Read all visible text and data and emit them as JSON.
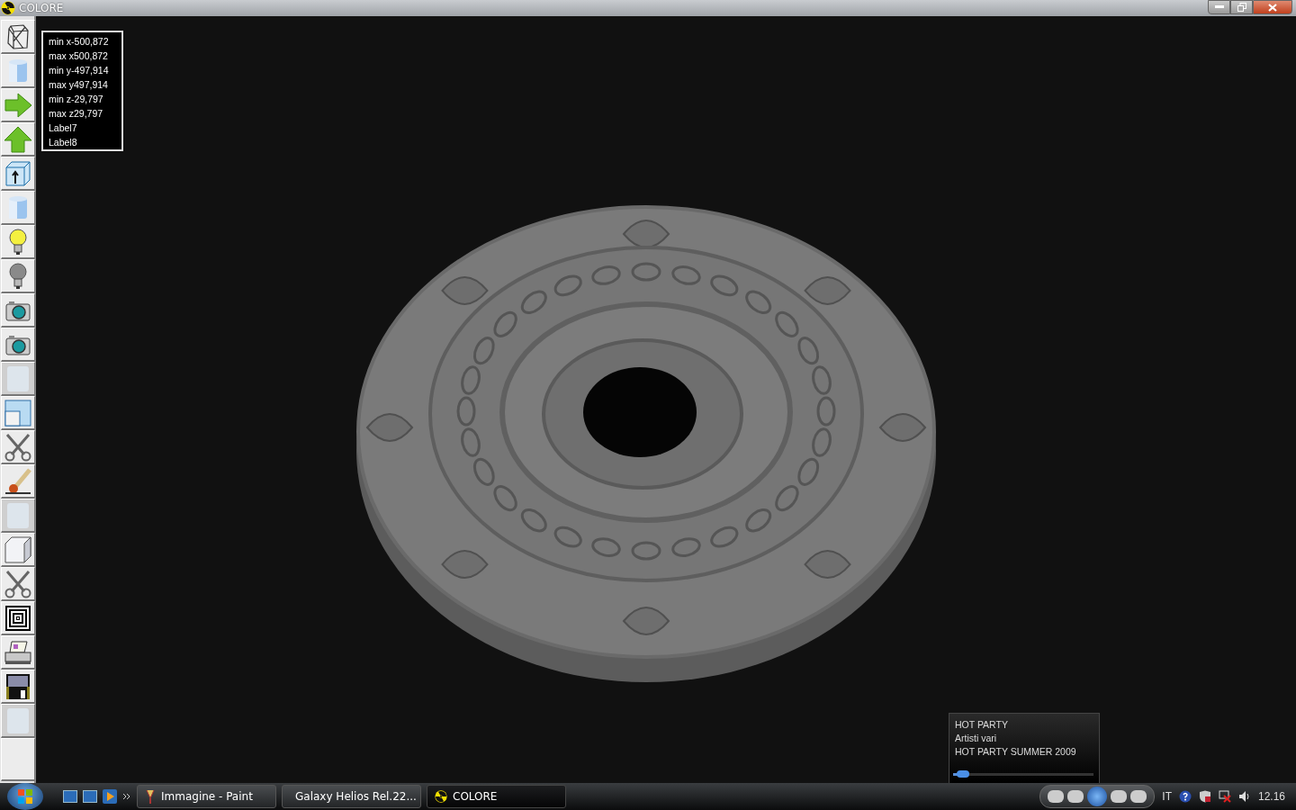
{
  "window": {
    "title": "COLORE"
  },
  "toolbar": [
    {
      "kind": "wireframe",
      "disabled": false
    },
    {
      "kind": "cylinder",
      "disabled": false
    },
    {
      "kind": "arrow-right",
      "disabled": false
    },
    {
      "kind": "arrow-up",
      "disabled": false
    },
    {
      "kind": "box-arrow",
      "disabled": false
    },
    {
      "kind": "cylinder",
      "disabled": false
    },
    {
      "kind": "bulb-on",
      "disabled": false
    },
    {
      "kind": "bulb-off",
      "disabled": false
    },
    {
      "kind": "camera",
      "disabled": false
    },
    {
      "kind": "camera",
      "disabled": false
    },
    {
      "kind": "blank",
      "disabled": true
    },
    {
      "kind": "window",
      "disabled": false
    },
    {
      "kind": "scissors",
      "disabled": false
    },
    {
      "kind": "brush",
      "disabled": false
    },
    {
      "kind": "blank",
      "disabled": true
    },
    {
      "kind": "cube",
      "disabled": false
    },
    {
      "kind": "scissors",
      "disabled": false
    },
    {
      "kind": "squares",
      "disabled": false
    },
    {
      "kind": "printer",
      "disabled": false
    },
    {
      "kind": "floppy",
      "disabled": false
    },
    {
      "kind": "blank",
      "disabled": true
    },
    {
      "kind": "empty",
      "disabled": false
    }
  ],
  "info": [
    "min x-500,872",
    "max x500,872",
    "min y-497,914",
    "max y497,914",
    "min z-29,797",
    "max z29,797",
    "Label7",
    "Label8"
  ],
  "player": {
    "lines": [
      "HOT PARTY",
      "Artisti vari",
      "HOT PARTY SUMMER 2009"
    ],
    "level": 0.07
  },
  "taskbar": {
    "tasks": [
      {
        "label": "Immagine - Paint",
        "kind": "paint",
        "selected": false
      },
      {
        "label": "Galaxy Helios  Rel.22...",
        "kind": "helios",
        "selected": false
      },
      {
        "label": "COLORE",
        "kind": "radiation",
        "selected": true
      }
    ],
    "language": "IT",
    "clock": "12.16"
  }
}
